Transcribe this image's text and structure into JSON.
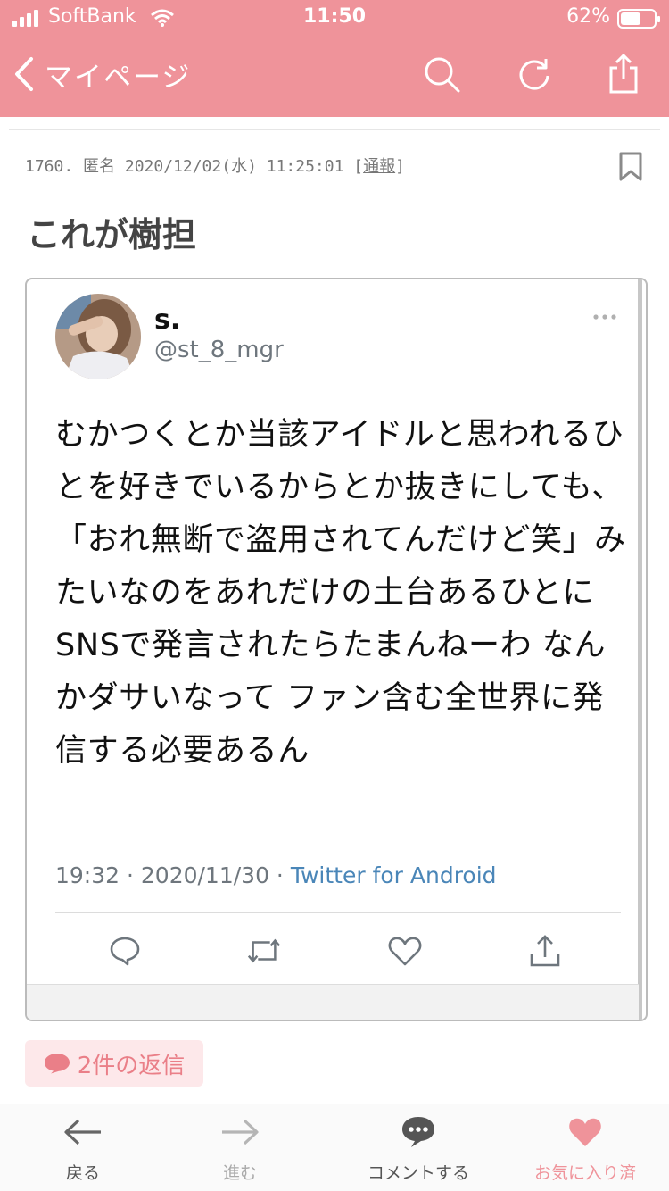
{
  "status_bar": {
    "carrier": "SoftBank",
    "time": "11:50",
    "battery_percent": "62%",
    "battery_level": 0.62
  },
  "nav": {
    "back_label": "マイページ",
    "icons": [
      "search-icon",
      "reload-icon",
      "share-icon"
    ],
    "color": "#ef939a"
  },
  "post": {
    "meta": "1760. 匿名 2020/12/02(水) 11:25:01 [",
    "report_link": "通報",
    "meta_close": "]",
    "title": "これが樹担"
  },
  "tweet": {
    "name": "s.",
    "handle": "@st_8_mgr",
    "more_icon": "more-dots-icon",
    "text": "むかつくとか当該アイドルと思われるひとを好きでいるからとか抜きにしても、「おれ無断で盗用されてんだけど笑」みたいなのをあれだけの土台あるひとにSNSで発言されたらたまんねーわ なんかダサいなって ファン含む全世界に発信する必要あるん",
    "timestamp": "19:32 · 2020/11/30 · ",
    "source": "Twitter for Android",
    "actions": [
      "reply-icon",
      "retweet-icon",
      "like-icon",
      "share-icon"
    ]
  },
  "replies": {
    "label": "2件の返信",
    "accent": "#ea7f88"
  },
  "tabbar": {
    "back": "戻る",
    "forward": "進む",
    "comment": "コメントする",
    "favorite": "お気に入り済"
  }
}
